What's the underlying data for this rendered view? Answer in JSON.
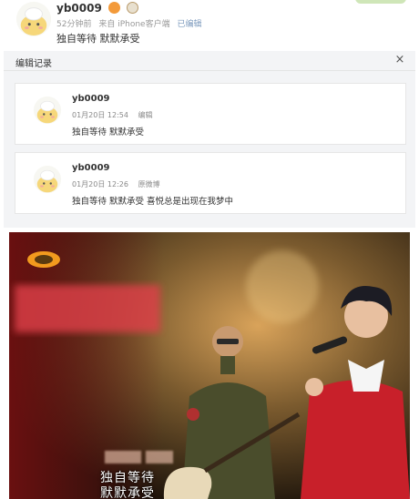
{
  "post": {
    "username": "yb0009",
    "time": "52分钟前",
    "source": "来自 iPhone客户端",
    "edited_label": "已编辑",
    "text": "独自等待 默默承受"
  },
  "history": {
    "title": "编辑记录",
    "close_symbol": "×",
    "entries": [
      {
        "username": "yb0009",
        "date": "01月20日 12:54",
        "tag": "编辑",
        "text": "独自等待 默默承受"
      },
      {
        "username": "yb0009",
        "date": "01月20日 12:26",
        "tag": "原微博",
        "text": "独自等待 默默承受 喜悦总是出现在我梦中"
      }
    ]
  },
  "video": {
    "subtitle_line1": "独自等待",
    "subtitle_line2": "默默承受"
  },
  "colors": {
    "panel_bg": "#f3f4f6",
    "meta_link": "#7c9abd",
    "stage_red": "#c8202a"
  },
  "icons": [
    "avatar-icon",
    "close-icon",
    "badge-icon"
  ]
}
